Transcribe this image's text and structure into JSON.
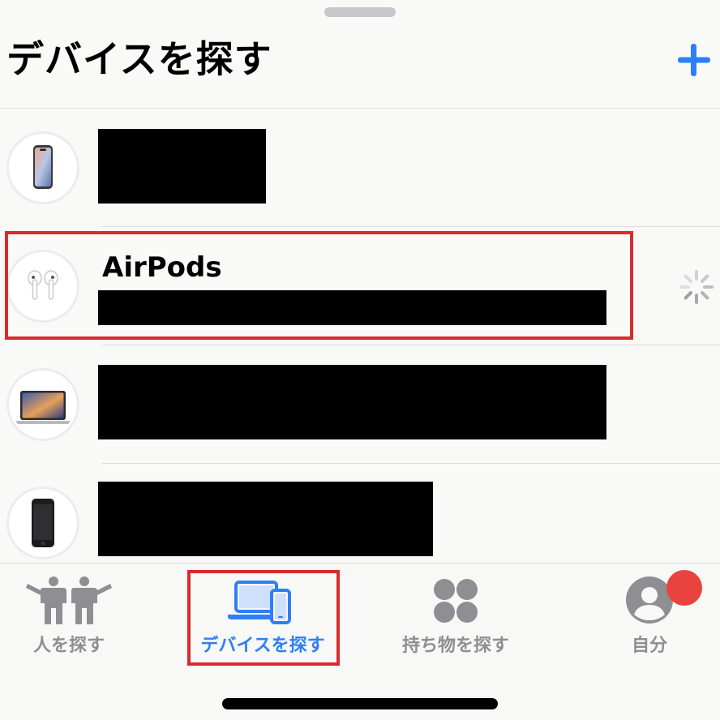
{
  "header": {
    "title": "デバイスを探す"
  },
  "devices": [
    {
      "name": "",
      "kind": "iphone-icon"
    },
    {
      "name": "AirPods",
      "kind": "airpods-icon",
      "status": "loading"
    },
    {
      "name": "",
      "kind": "macbook-icon"
    },
    {
      "name": "",
      "kind": "iphone-dark-icon"
    }
  ],
  "tabs": [
    {
      "label": "人を探す",
      "icon": "people-icon"
    },
    {
      "label": "デバイスを探す",
      "icon": "devices-icon",
      "active": true
    },
    {
      "label": "持ち物を探す",
      "icon": "items-icon"
    },
    {
      "label": "自分",
      "icon": "person-circle-icon"
    }
  ],
  "colors": {
    "accent": "#2d7ff7",
    "highlight": "#d72c2c",
    "badge": "#e9433e",
    "inactive": "#8e8e93"
  }
}
